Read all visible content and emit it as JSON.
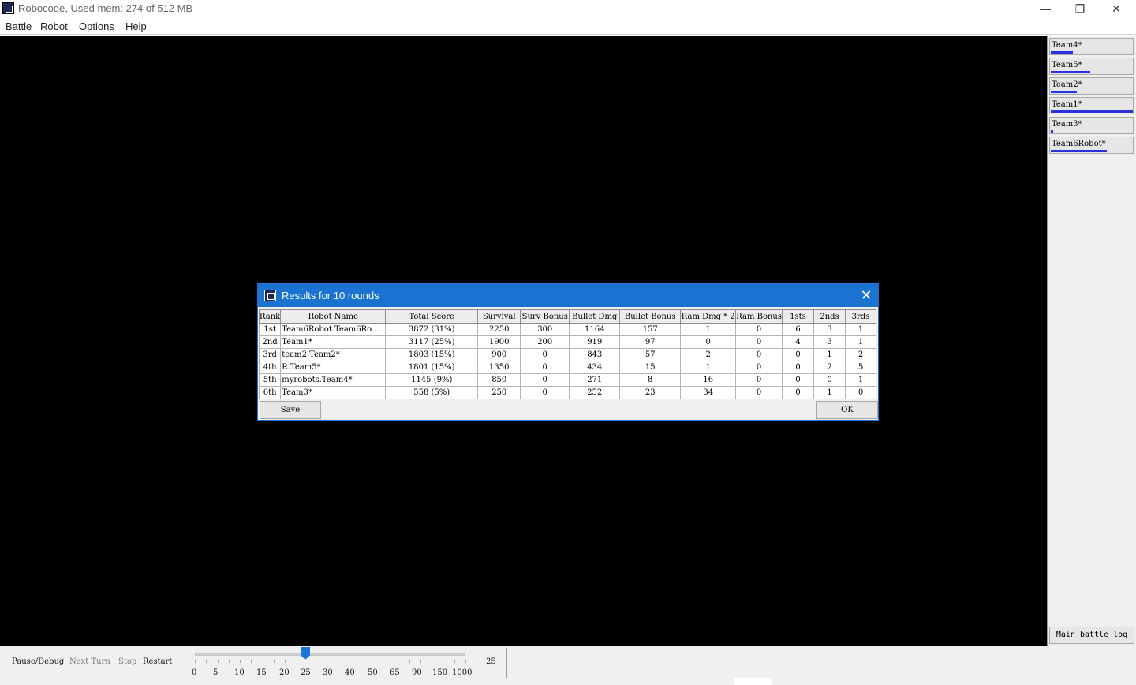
{
  "window": {
    "title": "Robocode, Used mem: 274 of 512 MB",
    "controls": {
      "minimize": "—",
      "maximize": "❐",
      "close": "✕"
    }
  },
  "menu": [
    "Battle",
    "Robot",
    "Options",
    "Help"
  ],
  "robots_panel": [
    {
      "name": "Team4*",
      "energy": 0.27
    },
    {
      "name": "Team5*",
      "energy": 0.48
    },
    {
      "name": "Team2*",
      "energy": 0.31
    },
    {
      "name": "Team1*",
      "energy": 0.99
    },
    {
      "name": "Team3*",
      "energy": 0.03
    },
    {
      "name": "Team6Robot*",
      "energy": 0.68
    }
  ],
  "main_battle_log_label": "Main battle log",
  "controls": {
    "pause_label": "Pause/Debug",
    "next_turn_label": "Next Turn",
    "stop_label": "Stop",
    "restart_label": "Restart",
    "speed_value": "25",
    "speed_ticks": [
      "0",
      "5",
      "10",
      "15",
      "20",
      "25",
      "30",
      "40",
      "50",
      "65",
      "90",
      "150",
      "1000"
    ],
    "speed_selected_index": 5
  },
  "dialog": {
    "title": "Results for 10 rounds",
    "close_icon": "✕",
    "columns": [
      "Rank",
      "Robot Name",
      "Total Score",
      "Survival",
      "Surv Bonus",
      "Bullet Dmg",
      "Bullet Bonus",
      "Ram Dmg * 2",
      "Ram Bonus",
      "1sts",
      "2nds",
      "3rds"
    ],
    "rows": [
      [
        "1st",
        "Team6Robot.Team6Ro...",
        "3872 (31%)",
        "2250",
        "300",
        "1164",
        "157",
        "1",
        "0",
        "6",
        "3",
        "1"
      ],
      [
        "2nd",
        "Team1*",
        "3117 (25%)",
        "1900",
        "200",
        "919",
        "97",
        "0",
        "0",
        "4",
        "3",
        "1"
      ],
      [
        "3rd",
        "team2.Team2*",
        "1803 (15%)",
        "900",
        "0",
        "843",
        "57",
        "2",
        "0",
        "0",
        "1",
        "2"
      ],
      [
        "4th",
        "R.Team5*",
        "1801 (15%)",
        "1350",
        "0",
        "434",
        "15",
        "1",
        "0",
        "0",
        "2",
        "5"
      ],
      [
        "5th",
        "myrobots.Team4*",
        "1145 (9%)",
        "850",
        "0",
        "271",
        "8",
        "16",
        "0",
        "0",
        "0",
        "1"
      ],
      [
        "6th",
        "Team3*",
        "558 (5%)",
        "250",
        "0",
        "252",
        "23",
        "34",
        "0",
        "0",
        "1",
        "0"
      ]
    ],
    "save_label": "Save",
    "ok_label": "OK"
  }
}
